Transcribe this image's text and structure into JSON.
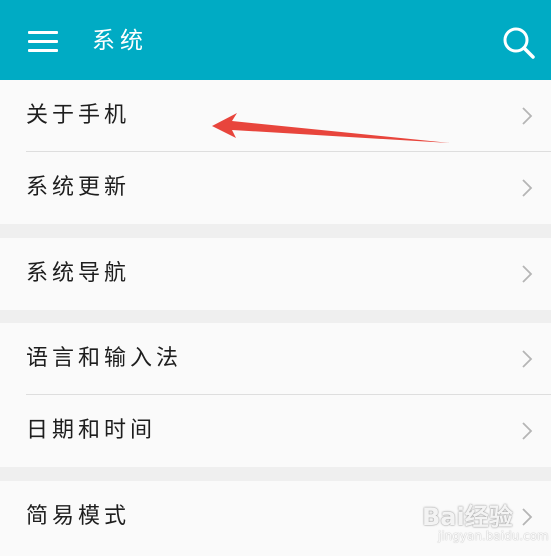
{
  "colors": {
    "header_bg": "#00abc4",
    "row_bg": "#fafafa",
    "page_bg": "#efefef",
    "divider": "#dedede",
    "annotation_arrow": "#e8453c"
  },
  "header": {
    "menu_icon": "hamburger-menu-icon",
    "title": "系统",
    "search_icon": "search-icon"
  },
  "groups": [
    {
      "items": [
        {
          "label": "关于手机",
          "icon": "chevron-right-icon"
        },
        {
          "label": "系统更新",
          "icon": "chevron-right-icon"
        }
      ]
    },
    {
      "items": [
        {
          "label": "系统导航",
          "icon": "chevron-right-icon"
        }
      ]
    },
    {
      "items": [
        {
          "label": "语言和输入法",
          "icon": "chevron-right-icon"
        },
        {
          "label": "日期和时间",
          "icon": "chevron-right-icon"
        }
      ]
    },
    {
      "items": [
        {
          "label": "简易模式",
          "icon": "chevron-right-icon"
        }
      ]
    }
  ],
  "watermark": {
    "logo_text": "Bai经验",
    "sub_text": "jingyan.baidu.com"
  }
}
